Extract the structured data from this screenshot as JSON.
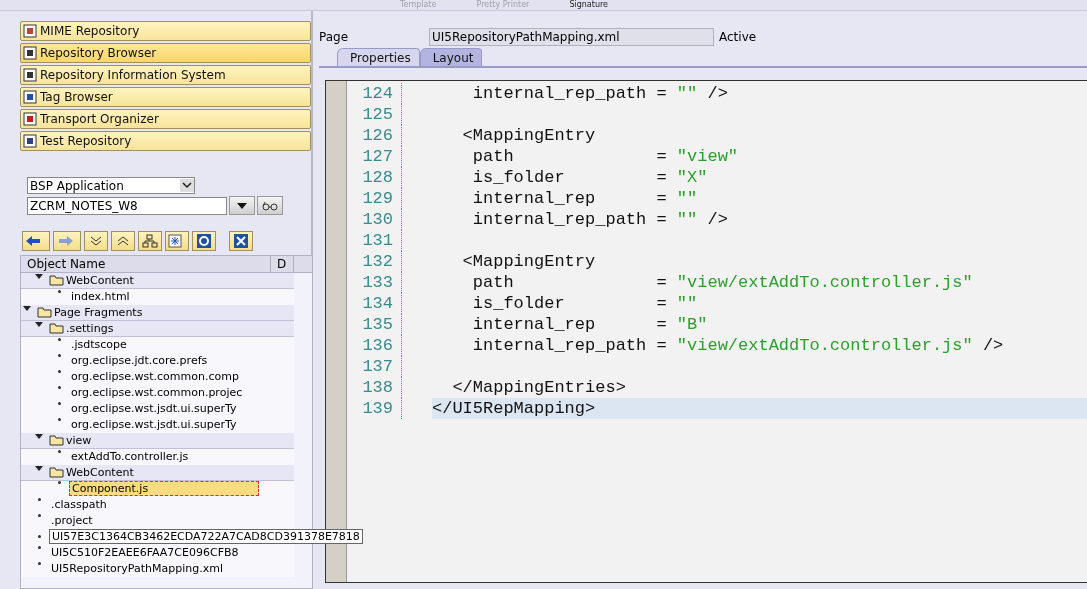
{
  "toolbar": {
    "items": [
      {
        "label": "Template",
        "disabled": true
      },
      {
        "label": "Pretty Printer",
        "disabled": true
      },
      {
        "label": "Signature",
        "disabled": false
      }
    ]
  },
  "navigation": [
    {
      "label": "MIME Repository",
      "selected": false
    },
    {
      "label": "Repository Browser",
      "selected": true
    },
    {
      "label": "Repository Information System",
      "selected": false
    },
    {
      "label": "Tag Browser",
      "selected": false
    },
    {
      "label": "Transport Organizer",
      "selected": false
    },
    {
      "label": "Test Repository",
      "selected": false
    }
  ],
  "object_type": {
    "value": "BSP Application"
  },
  "object_name": {
    "value": "ZCRM_NOTES_W8"
  },
  "tree": {
    "columns": [
      "Object Name",
      "D"
    ],
    "items": [
      {
        "children": [
          {
            "label": "WebContent",
            "kind": "folder",
            "expanded": true,
            "selected": false,
            "children": [
              {
                "label": "index.html",
                "kind": "file",
                "selected": false
              }
            ]
          }
        ]
      },
      {
        "label": "Page Fragments",
        "kind": "folder",
        "expanded": true,
        "selected": false,
        "children": [
          {
            "label": ".settings",
            "kind": "folder",
            "expanded": true,
            "selected": false,
            "children": [
              {
                "label": ".jsdtscope",
                "kind": "file",
                "selected": false
              },
              {
                "label": "org.eclipse.jdt.core.prefs",
                "kind": "file",
                "selected": false
              },
              {
                "label": "org.eclipse.wst.common.comp",
                "kind": "file",
                "selected": false
              },
              {
                "label": "org.eclipse.wst.common.projec",
                "kind": "file",
                "selected": false
              },
              {
                "label": "org.eclipse.wst.jsdt.ui.superTy",
                "kind": "file",
                "selected": false
              },
              {
                "label": "org.eclipse.wst.jsdt.ui.superTy",
                "kind": "file",
                "selected": false
              }
            ]
          },
          {
            "label": "view",
            "kind": "folder",
            "expanded": true,
            "selected": false,
            "children": [
              {
                "label": "extAddTo.controller.js",
                "kind": "file",
                "selected": false
              }
            ]
          },
          {
            "label": "WebContent",
            "kind": "folder",
            "expanded": true,
            "selected": false,
            "children": [
              {
                "label": "Component.js",
                "kind": "file",
                "selected": true
              }
            ]
          },
          {
            "label": ".classpath",
            "kind": "file",
            "selected": false
          },
          {
            "label": ".project",
            "kind": "file",
            "selected": false
          },
          {
            "label": "UI57E3C1364CB3462ECDA722A7CAD8CD391378E7818",
            "kind": "file",
            "selected": false,
            "tooltip": true
          },
          {
            "label": "UI5C510F2EAEE6FAA7CE096CFB8",
            "kind": "file",
            "selected": false
          },
          {
            "label": "UI5RepositoryPathMapping.xml",
            "kind": "file",
            "selected": false
          }
        ]
      }
    ]
  },
  "page": {
    "label": "Page",
    "value": "UI5RepositoryPathMapping.xml",
    "status": "Active"
  },
  "tabs": [
    {
      "label": "Properties",
      "selected": false
    },
    {
      "label": "Layout",
      "selected": true
    }
  ],
  "editor": {
    "lines": [
      {
        "number": "124",
        "current": false,
        "segments": [
          {
            "kind": "plain",
            "text": "    internal_rep_path = "
          },
          {
            "kind": "string",
            "text": "\"\""
          },
          {
            "kind": "plain",
            "text": " />"
          }
        ]
      },
      {
        "number": "125",
        "current": false
      },
      {
        "number": "126",
        "current": false,
        "segments": [
          {
            "kind": "plain",
            "text": "   <MappingEntry"
          }
        ]
      },
      {
        "number": "127",
        "current": false,
        "segments": [
          {
            "kind": "plain",
            "text": "    path              = "
          },
          {
            "kind": "string",
            "text": "\"view\""
          }
        ]
      },
      {
        "number": "128",
        "current": false,
        "segments": [
          {
            "kind": "plain",
            "text": "    is_folder         = "
          },
          {
            "kind": "string",
            "text": "\"X\""
          }
        ]
      },
      {
        "number": "129",
        "current": false,
        "segments": [
          {
            "kind": "plain",
            "text": "    internal_rep      = "
          },
          {
            "kind": "string",
            "text": "\"\""
          }
        ]
      },
      {
        "number": "130",
        "current": false,
        "segments": [
          {
            "kind": "plain",
            "text": "    internal_rep_path = "
          },
          {
            "kind": "string",
            "text": "\"\""
          },
          {
            "kind": "plain",
            "text": " />"
          }
        ]
      },
      {
        "number": "131",
        "current": false
      },
      {
        "number": "132",
        "current": false,
        "segments": [
          {
            "kind": "plain",
            "text": "   <MappingEntry"
          }
        ]
      },
      {
        "number": "133",
        "current": false,
        "segments": [
          {
            "kind": "plain",
            "text": "    path              = "
          },
          {
            "kind": "string",
            "text": "\"view/extAddTo.controller.js\""
          }
        ]
      },
      {
        "number": "134",
        "current": false,
        "segments": [
          {
            "kind": "plain",
            "text": "    is_folder         = "
          },
          {
            "kind": "string",
            "text": "\"\""
          }
        ]
      },
      {
        "number": "135",
        "current": false,
        "segments": [
          {
            "kind": "plain",
            "text": "    internal_rep      = "
          },
          {
            "kind": "string",
            "text": "\"B\""
          }
        ]
      },
      {
        "number": "136",
        "current": false,
        "segments": [
          {
            "kind": "plain",
            "text": "    internal_rep_path = "
          },
          {
            "kind": "string",
            "text": "\"view/extAddTo.controller.js\""
          },
          {
            "kind": "plain",
            "text": " />"
          }
        ]
      },
      {
        "number": "137",
        "current": false
      },
      {
        "number": "138",
        "current": false,
        "segments": [
          {
            "kind": "plain",
            "text": "  </MappingEntries>"
          }
        ]
      },
      {
        "number": "139",
        "current": true,
        "segments": [
          {
            "kind": "plain",
            "text": "</UI5RepMapping>"
          }
        ]
      }
    ]
  }
}
